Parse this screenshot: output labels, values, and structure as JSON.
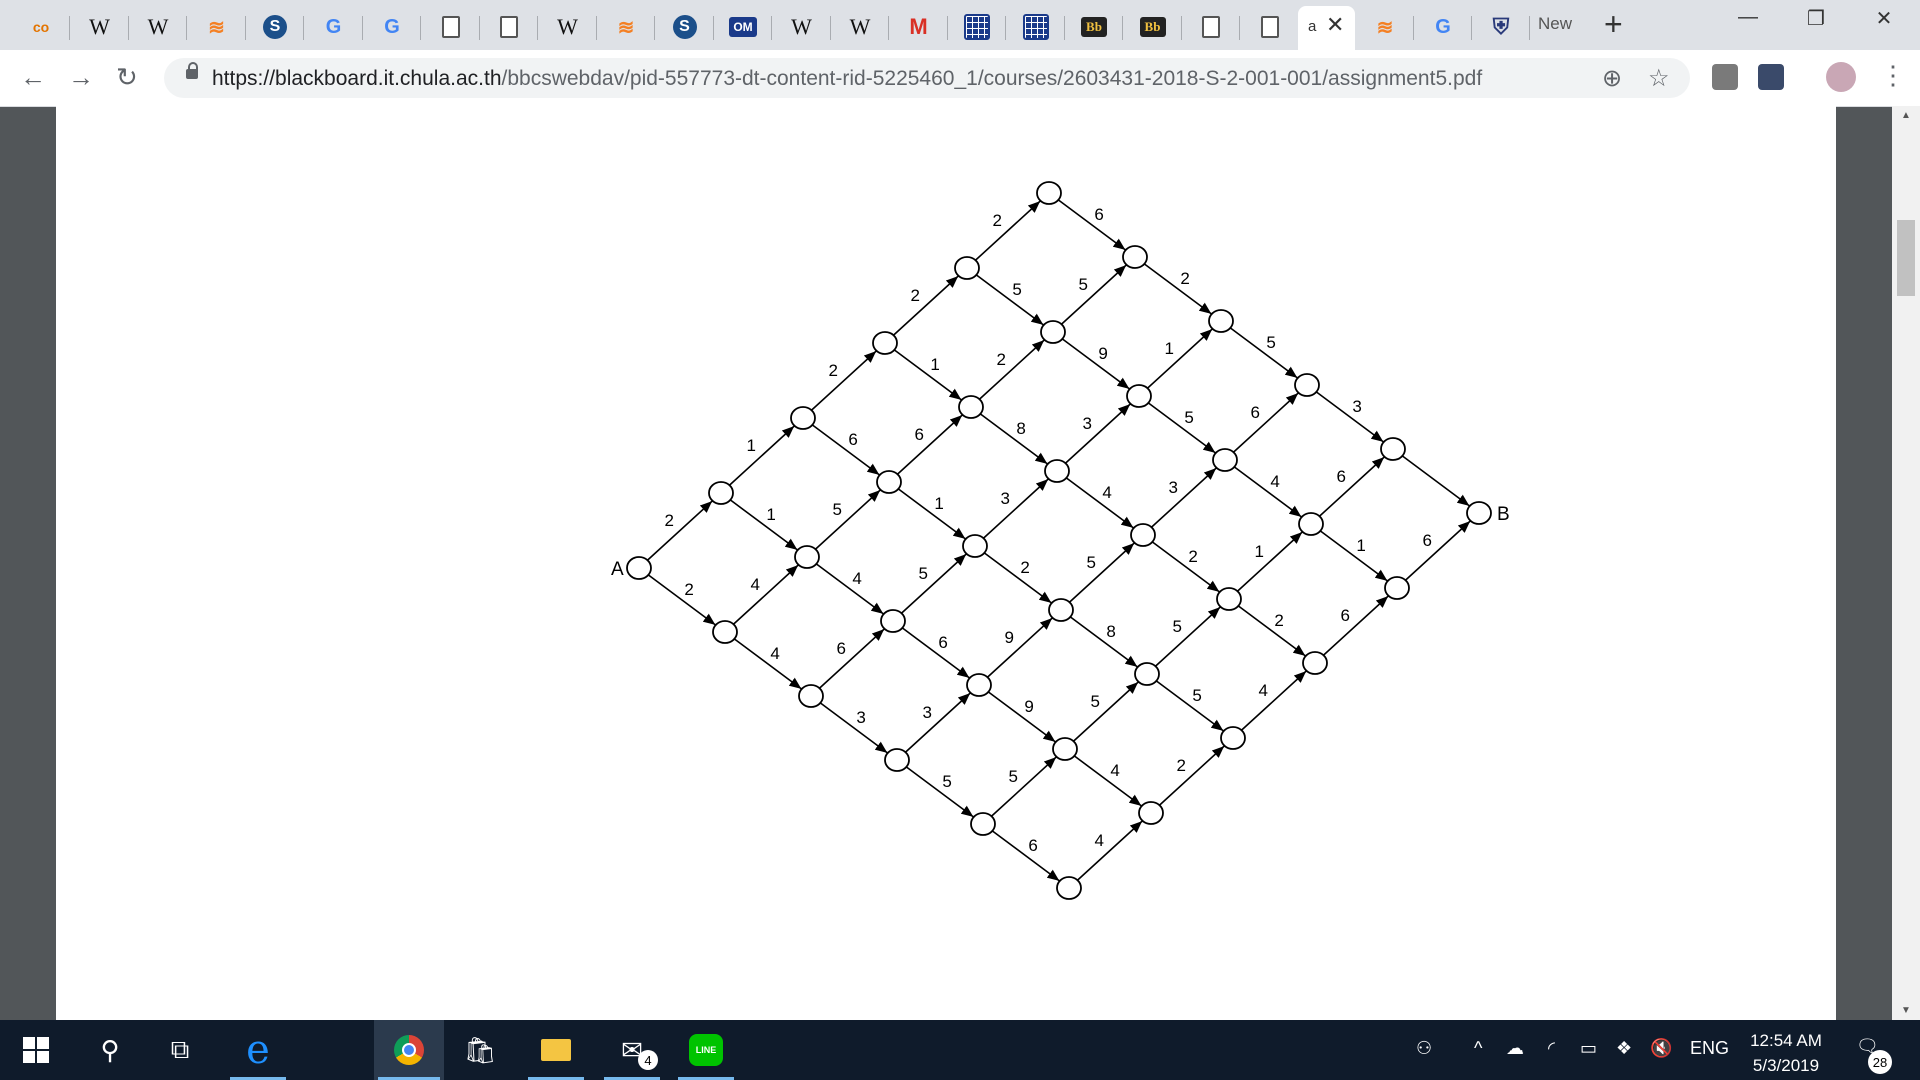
{
  "browser": {
    "tabs": [
      {
        "icon": "colab-icon",
        "glyph": "co"
      },
      {
        "icon": "wikipedia-icon",
        "glyph": "W"
      },
      {
        "icon": "wikipedia-icon",
        "glyph": "W"
      },
      {
        "icon": "stackoverflow-icon",
        "glyph": "≋"
      },
      {
        "icon": "s-logo-icon",
        "glyph": "S"
      },
      {
        "icon": "google-icon",
        "glyph": "G"
      },
      {
        "icon": "google-icon",
        "glyph": "G"
      },
      {
        "icon": "document-icon",
        "glyph": ""
      },
      {
        "icon": "document-icon",
        "glyph": ""
      },
      {
        "icon": "wikipedia-icon",
        "glyph": "W"
      },
      {
        "icon": "stackoverflow-icon",
        "glyph": "≋"
      },
      {
        "icon": "s-logo-icon",
        "glyph": "S"
      },
      {
        "icon": "om-icon",
        "glyph": "OM"
      },
      {
        "icon": "wikipedia-icon",
        "glyph": "W"
      },
      {
        "icon": "wikipedia-icon",
        "glyph": "W"
      },
      {
        "icon": "gmail-icon",
        "glyph": "M"
      },
      {
        "icon": "calendar-grid-icon",
        "glyph": ""
      },
      {
        "icon": "calendar-grid-icon",
        "glyph": ""
      },
      {
        "icon": "blackboard-icon",
        "glyph": "Bb"
      },
      {
        "icon": "blackboard-icon",
        "glyph": "Bb"
      },
      {
        "icon": "document-icon",
        "glyph": ""
      },
      {
        "icon": "document-icon",
        "glyph": ""
      }
    ],
    "active_tab_title": "a",
    "tabs_after": [
      {
        "icon": "stackoverflow-icon",
        "glyph": "≋"
      },
      {
        "icon": "google-icon",
        "glyph": "G"
      },
      {
        "icon": "shield-icon",
        "glyph": "⛨"
      }
    ],
    "new_tab_title": "New",
    "url_host": "https://blackboard.it.chula.ac.th",
    "url_path": "/bbcswebdav/pid-557773-dt-content-rid-5225460_1/courses/2603431-2018-S-2-001-001/assignment5.pdf"
  },
  "figure": {
    "start_label": "A",
    "end_label": "B",
    "edge_weights": [
      "2",
      "2",
      "4",
      "4",
      "6",
      "3",
      "3",
      "5",
      "5",
      "6",
      "4",
      "1",
      "1",
      "5",
      "4",
      "5",
      "6",
      "9",
      "9",
      "5",
      "4",
      "2",
      "2",
      "6",
      "6",
      "1",
      "3",
      "2",
      "5",
      "8",
      "5",
      "5",
      "4",
      "2",
      "1",
      "2",
      "8",
      "3",
      "4",
      "3",
      "2",
      "1",
      "2",
      "6",
      "2",
      "5",
      "5",
      "9",
      "1",
      "5",
      "6",
      "4",
      "6",
      "1",
      "6",
      "6",
      "2",
      "5",
      "3"
    ]
  },
  "taskbar": {
    "mail_badge": "4",
    "language": "ENG",
    "time": "12:54 AM",
    "date": "5/3/2019",
    "notification_count": "28"
  }
}
